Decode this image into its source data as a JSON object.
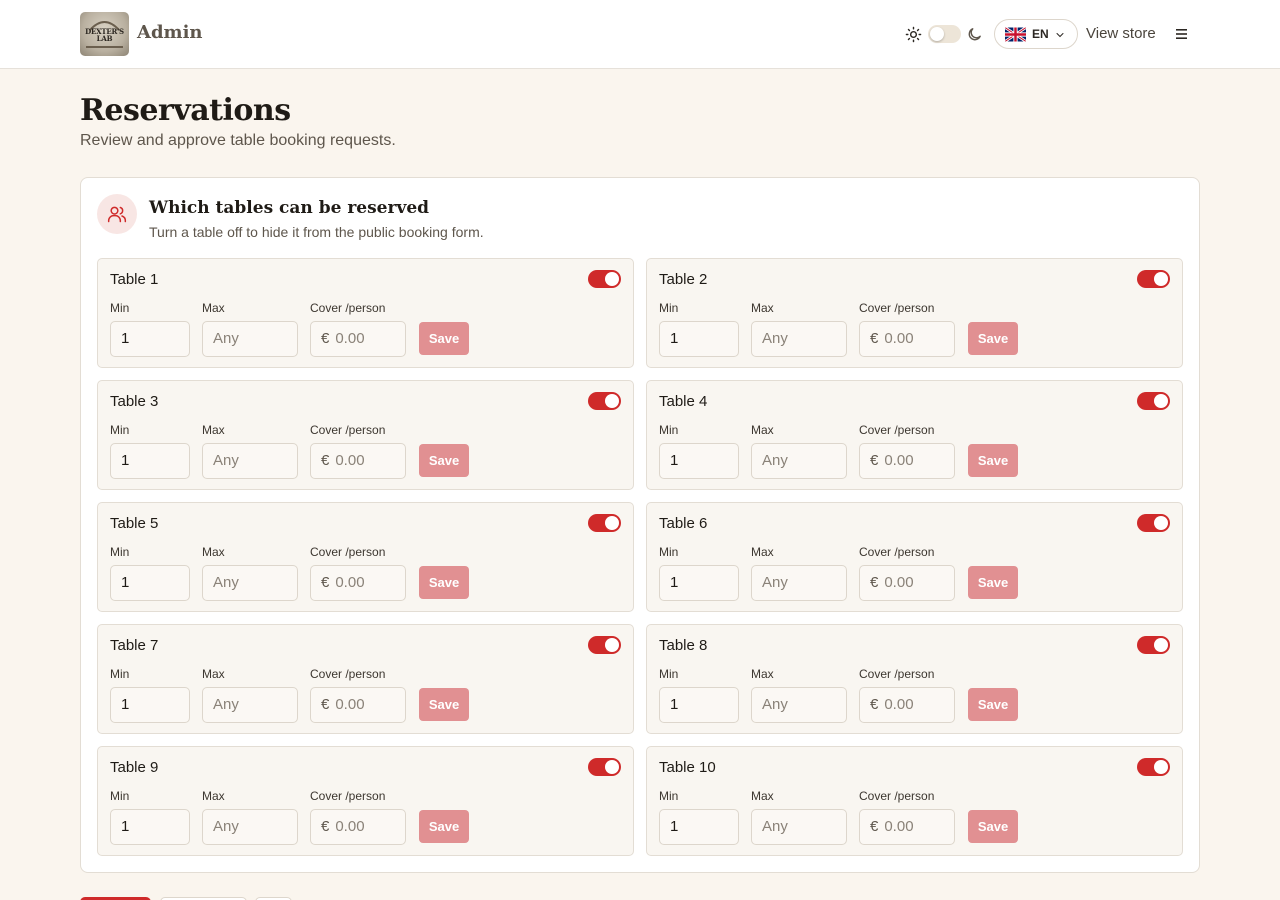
{
  "header": {
    "logo_text": "DEXTER'S LAB",
    "brand": "Admin",
    "icons": {
      "sun": "sun-icon",
      "moon": "moon-icon",
      "menu": "hamburger-menu-icon",
      "chevron": "chevron-down-icon",
      "flag": "uk-flag-icon"
    },
    "language": "EN",
    "view_store": "View store",
    "theme_dark": false
  },
  "page": {
    "title": "Reservations",
    "subtitle": "Review and approve table booking requests."
  },
  "panel": {
    "icon": "users-icon",
    "title": "Which tables can be reserved",
    "description": "Turn a table off to hide it from the public booking form."
  },
  "labels": {
    "min": "Min",
    "max": "Max",
    "cover": "Cover /person",
    "save": "Save",
    "currency": "€"
  },
  "tables": [
    {
      "name": "Table 1",
      "enabled": true,
      "min": "1",
      "max_placeholder": "Any",
      "cover_placeholder": "0.00"
    },
    {
      "name": "Table 2",
      "enabled": true,
      "min": "1",
      "max_placeholder": "Any",
      "cover_placeholder": "0.00"
    },
    {
      "name": "Table 3",
      "enabled": true,
      "min": "1",
      "max_placeholder": "Any",
      "cover_placeholder": "0.00"
    },
    {
      "name": "Table 4",
      "enabled": true,
      "min": "1",
      "max_placeholder": "Any",
      "cover_placeholder": "0.00"
    },
    {
      "name": "Table 5",
      "enabled": true,
      "min": "1",
      "max_placeholder": "Any",
      "cover_placeholder": "0.00"
    },
    {
      "name": "Table 6",
      "enabled": true,
      "min": "1",
      "max_placeholder": "Any",
      "cover_placeholder": "0.00"
    },
    {
      "name": "Table 7",
      "enabled": true,
      "min": "1",
      "max_placeholder": "Any",
      "cover_placeholder": "0.00"
    },
    {
      "name": "Table 8",
      "enabled": true,
      "min": "1",
      "max_placeholder": "Any",
      "cover_placeholder": "0.00"
    },
    {
      "name": "Table 9",
      "enabled": true,
      "min": "1",
      "max_placeholder": "Any",
      "cover_placeholder": "0.00"
    },
    {
      "name": "Table 10",
      "enabled": true,
      "min": "1",
      "max_placeholder": "Any",
      "cover_placeholder": "0.00"
    }
  ],
  "colors": {
    "accent": "#cf2a2a",
    "save_disabled": "#e19092",
    "background": "#faf5ee"
  }
}
